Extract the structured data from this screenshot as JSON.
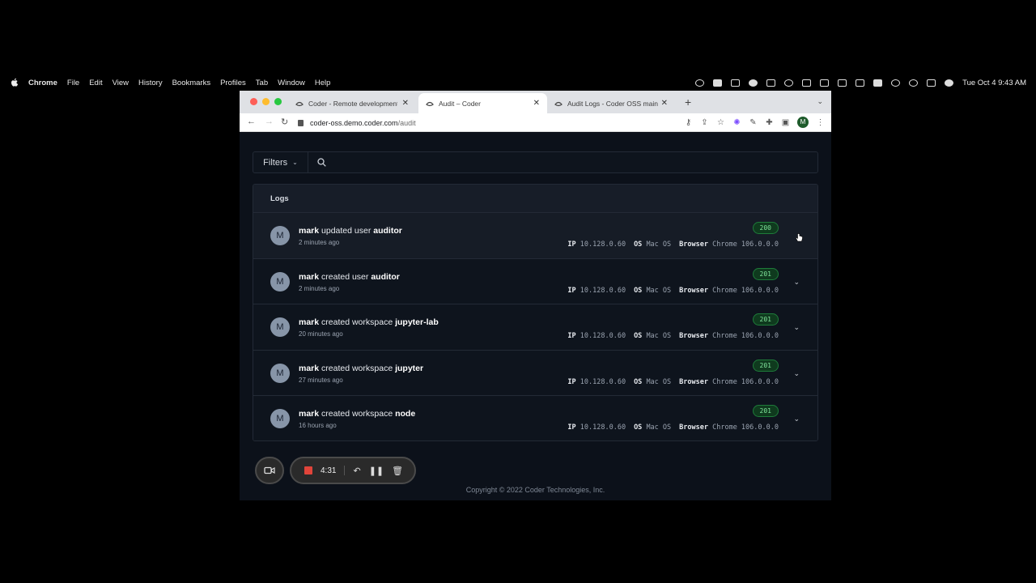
{
  "menubar": {
    "app": "Chrome",
    "items": [
      "File",
      "Edit",
      "View",
      "History",
      "Bookmarks",
      "Profiles",
      "Tab",
      "Window",
      "Help"
    ],
    "clock": "Tue Oct 4  9:43 AM"
  },
  "browser": {
    "tabs": [
      {
        "label": "Coder - Remote development"
      },
      {
        "label": "Audit – Coder"
      },
      {
        "label": "Audit Logs - Coder OSS main"
      }
    ],
    "url_host": "coder-oss.demo.coder.com",
    "url_path": "/audit",
    "profile_initial": "M"
  },
  "filters": {
    "button_label": "Filters",
    "search_placeholder": ""
  },
  "logs": {
    "heading": "Logs",
    "rows": [
      {
        "avatar": "M",
        "user": "mark",
        "action": " updated user ",
        "target": "auditor",
        "time": "2 minutes ago",
        "status": "200",
        "ip_label": "IP",
        "ip": "10.128.0.60",
        "os_label": "OS",
        "os": "Mac OS",
        "browser_label": "Browser",
        "browser": "Chrome 106.0.0.0"
      },
      {
        "avatar": "M",
        "user": "mark",
        "action": " created user ",
        "target": "auditor",
        "time": "2 minutes ago",
        "status": "201",
        "ip_label": "IP",
        "ip": "10.128.0.60",
        "os_label": "OS",
        "os": "Mac OS",
        "browser_label": "Browser",
        "browser": "Chrome 106.0.0.0"
      },
      {
        "avatar": "M",
        "user": "mark",
        "action": " created workspace ",
        "target": "jupyter-lab",
        "time": "20 minutes ago",
        "status": "201",
        "ip_label": "IP",
        "ip": "10.128.0.60",
        "os_label": "OS",
        "os": "Mac OS",
        "browser_label": "Browser",
        "browser": "Chrome 106.0.0.0"
      },
      {
        "avatar": "M",
        "user": "mark",
        "action": " created workspace ",
        "target": "jupyter",
        "time": "27 minutes ago",
        "status": "201",
        "ip_label": "IP",
        "ip": "10.128.0.60",
        "os_label": "OS",
        "os": "Mac OS",
        "browser_label": "Browser",
        "browser": "Chrome 106.0.0.0"
      },
      {
        "avatar": "M",
        "user": "mark",
        "action": " created workspace ",
        "target": "node",
        "time": "16 hours ago",
        "status": "201",
        "ip_label": "IP",
        "ip": "10.128.0.60",
        "os_label": "OS",
        "os": "Mac OS",
        "browser_label": "Browser",
        "browser": "Chrome 106.0.0.0"
      }
    ]
  },
  "footer": {
    "copyright": "Copyright © 2022 Coder Technologies, Inc."
  },
  "recorder": {
    "elapsed": "4:31"
  },
  "colors": {
    "page_bg": "#0c111a",
    "status_green": "#7fe39a",
    "record_red": "#e0443a"
  }
}
